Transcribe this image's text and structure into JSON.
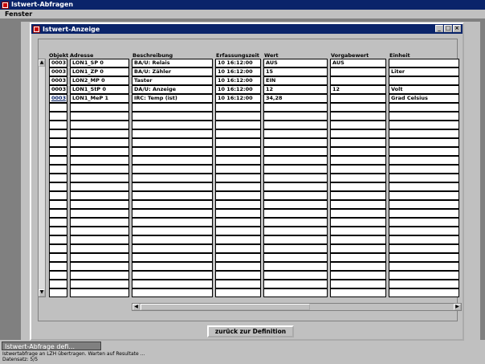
{
  "app": {
    "title": "Istwert-Abfragen",
    "menu": [
      "Fenster"
    ]
  },
  "inner_window": {
    "title": "Istwert-Anzeige"
  },
  "columns": [
    "Objekt",
    "Adresse",
    "Beschreibung",
    "Erfassungszeit",
    "Wert",
    "Vorgabewert",
    "Einheit"
  ],
  "rows": [
    [
      "0003",
      "LON1_SP 0",
      "BA/U: Relais",
      "10 16:12:00",
      "AUS",
      "AUS",
      ""
    ],
    [
      "0003",
      "LON1_ZP 0",
      "BA/U: Zähler",
      "10 16:12:00",
      "15",
      "",
      "Liter"
    ],
    [
      "0003",
      "LON2_MP 0",
      "Taster",
      "10 16:12:00",
      "EIN",
      "",
      ""
    ],
    [
      "0003",
      "LON1_StP 0",
      "DA/U: Anzeige",
      "10 16:12:00",
      "12",
      "12",
      "Volt"
    ],
    [
      "0003",
      "LON1_MeP 1",
      "IRC: Temp (ist)",
      "10 16:12:00",
      "34,28",
      "",
      "Grad Celsius"
    ]
  ],
  "back_button": "zurück zur Definition",
  "taskbar_tab": "Istwert-Abfrage defi...",
  "status_line1": "Istwertabfrage an LZH übertragen. Warten auf Resultate ...",
  "status_line2": "Datensatz: 5/5"
}
